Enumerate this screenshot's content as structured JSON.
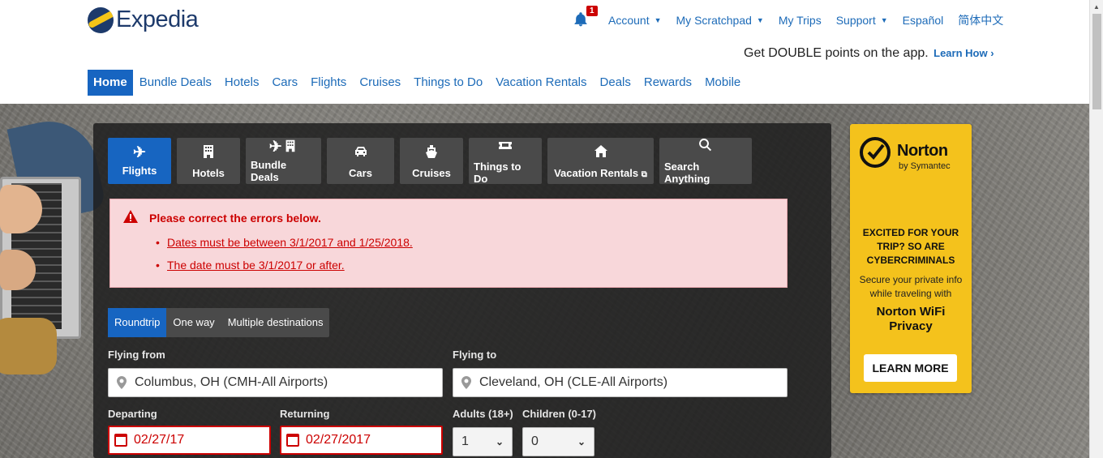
{
  "brand": {
    "name": "Expedia"
  },
  "util_nav": {
    "notification_count": "1",
    "items": [
      {
        "label": "Account",
        "has_caret": true
      },
      {
        "label": "My Scratchpad",
        "has_caret": true
      },
      {
        "label": "My Trips",
        "has_caret": false
      },
      {
        "label": "Support",
        "has_caret": true
      },
      {
        "label": "Español",
        "has_caret": false
      },
      {
        "label": "简体中文",
        "has_caret": false
      }
    ]
  },
  "promo": {
    "text": "Get DOUBLE points on the app.",
    "link": "Learn How ›"
  },
  "main_nav": {
    "home": "Home",
    "bundle": "Bundle Deals",
    "hotels": "Hotels",
    "cars": "Cars",
    "flights": "Flights",
    "cruises": "Cruises",
    "things": "Things to Do",
    "vacation": "Vacation Rentals",
    "deals": "Deals",
    "rewards": "Rewards",
    "mobile": "Mobile"
  },
  "tabs": {
    "flights": "Flights",
    "hotels": "Hotels",
    "bundle": "Bundle Deals",
    "cars": "Cars",
    "cruises": "Cruises",
    "things": "Things to Do",
    "vacation": "Vacation Rentals",
    "search": "Search Anything"
  },
  "errors": {
    "title": "Please correct the errors below.",
    "items": [
      "Dates must be between 3/1/2017 and 1/25/2018.",
      "The date must be 3/1/2017 or after."
    ]
  },
  "trip_type": {
    "roundtrip": "Roundtrip",
    "oneway": "One way",
    "multi": "Multiple destinations"
  },
  "form": {
    "from_label": "Flying from",
    "from_value": "Columbus, OH (CMH-All Airports)",
    "to_label": "Flying to",
    "to_value": "Cleveland, OH (CLE-All Airports)",
    "depart_label": "Departing",
    "depart_value": "02/27/17",
    "return_label": "Returning",
    "return_value": "02/27/2017",
    "adults_label": "Adults (18+)",
    "adults_value": "1",
    "children_label": "Children (0-17)",
    "children_value": "0"
  },
  "ad": {
    "brand": "Norton",
    "brand_sub": "by Symantec",
    "headline": "EXCITED FOR YOUR TRIP? SO ARE CYBERCRIMINALS",
    "copy": "Secure your private info while traveling with",
    "product": "Norton WiFi Privacy",
    "cta": "LEARN MORE"
  },
  "colors": {
    "brand_blue": "#1765c1",
    "link_blue": "#1d6bb8",
    "error_red": "#cc0000",
    "ad_yellow": "#f4c21c"
  }
}
